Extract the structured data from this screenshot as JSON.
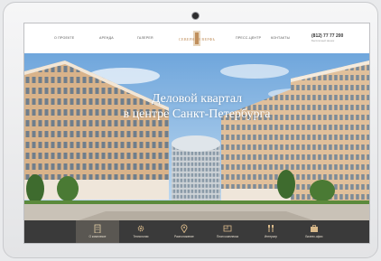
{
  "header": {
    "nav": [
      "О проекте",
      "Аренда",
      "Галерея",
      "Пресс-центр",
      "Контакты"
    ],
    "logo_text": "СЕВЕРНАЯ ВЕРФЬ",
    "phone": "(812) 77 77 200",
    "phone_sub": "Бесплатный звонок"
  },
  "hero": {
    "title_line1": "Деловой квартал",
    "title_line2": "в центре Санкт-Петербурга"
  },
  "bottom_nav": [
    {
      "label": "О комплексе",
      "icon": "building-icon"
    },
    {
      "label": "Технологии",
      "icon": "gear-icon"
    },
    {
      "label": "Расположение",
      "icon": "location-pin-icon"
    },
    {
      "label": "План комплекса",
      "icon": "floor-plan-icon"
    },
    {
      "label": "Интерьер",
      "icon": "interior-icon"
    },
    {
      "label": "Бизнес-офис",
      "icon": "briefcase-icon"
    }
  ],
  "colors": {
    "accent": "#c08f5c",
    "bottom_bar": "#3a3a3a",
    "sky": "#8fbde6"
  }
}
